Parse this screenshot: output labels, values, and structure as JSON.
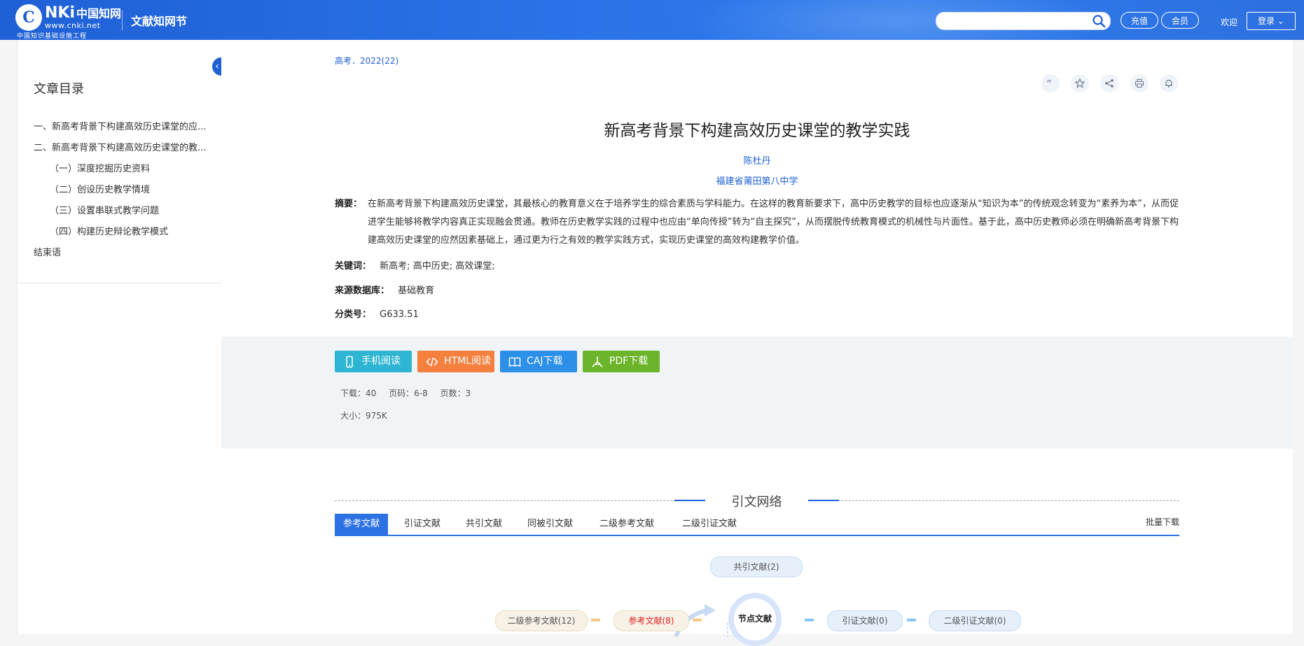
{
  "header": {
    "logo_mark": "C",
    "logo_text": "NKi",
    "logo_cn": "中国知网",
    "logo_url": "www.cnki.net",
    "logo_sub": "中国知识基础设施工程",
    "site_name": "文献知网节",
    "search_placeholder": "",
    "recharge_label": "充值",
    "member_label": "会员",
    "welcome_text": "欢迎",
    "login_label": "登录",
    "brand_color": "#1f60d6"
  },
  "sidebar": {
    "title": "文章目录",
    "items": [
      {
        "label": "一、新高考背景下构建高效历史课堂的应..."
      },
      {
        "label": "二、新高考背景下构建高效历史课堂的教..."
      },
      {
        "label": "（一）深度挖掘历史资料"
      },
      {
        "label": "（二）创设历史教学情境"
      },
      {
        "label": "（三）设置串联式教学问题"
      },
      {
        "label": "（四）构建历史辩论教学模式"
      },
      {
        "label": "结束语"
      }
    ]
  },
  "article": {
    "source": "高考．2022(22)",
    "tools": [
      "quote-icon",
      "star-icon",
      "share-icon",
      "print-icon",
      "bell-icon"
    ],
    "title": "新高考背景下构建高效历史课堂的教学实践",
    "author": "陈杜丹",
    "affiliation": "福建省莆田第八中学",
    "abstract_label": "摘要：",
    "abstract": "在新高考背景下构建高效历史课堂，其最核心的教育意义在于培养学生的综合素质与学科能力。在这样的教育新要求下，高中历史教学的目标也应逐渐从“知识为本”的传统观念转变为“素养为本”，从而促进学生能够将教学内容真正实现融会贯通。教师在历史教学实践的过程中也应由“单向传授”转为“自主探究”，从而摆脱传统教育模式的机械性与片面性。基于此，高中历史教师必须在明确新高考背景下构建高效历史课堂的应然因素基础上，通过更为行之有效的教学实践方式，实现历史课堂的高效构建教学价值。",
    "keywords_label": "关键词：",
    "keywords": [
      "新高考;",
      "高中历史;",
      "高效课堂;"
    ],
    "database_label": "来源数据库：",
    "database": "基础教育",
    "class_label": "分类号：",
    "class_no": "G633.51"
  },
  "downloads": {
    "buttons": [
      {
        "label": "手机阅读",
        "color": "#2db5d3"
      },
      {
        "label": "HTML阅读",
        "color": "#f5803e"
      },
      {
        "label": "CAJ下载",
        "color": "#2c8fe8"
      },
      {
        "label": "PDF下载",
        "color": "#6cb52a"
      }
    ],
    "stats": {
      "downloads": "下载：40",
      "pages_range": "页码：6-8",
      "page_count": "页数：3",
      "size": "大小：975K"
    }
  },
  "network": {
    "title": "引文网络",
    "tabs": [
      "参考文献",
      "引证文献",
      "共引文献",
      "同被引文献",
      "二级参考文献",
      "二级引证文献"
    ],
    "batch_download": "批量下载",
    "nodes": {
      "co_cite": "共引文献(2)",
      "second_ref": "二级参考文献(12)",
      "ref": "参考文献(8)",
      "center": "节点文献",
      "cite": "引证文献(0)",
      "second_cite": "二级引证文献(0)"
    }
  }
}
